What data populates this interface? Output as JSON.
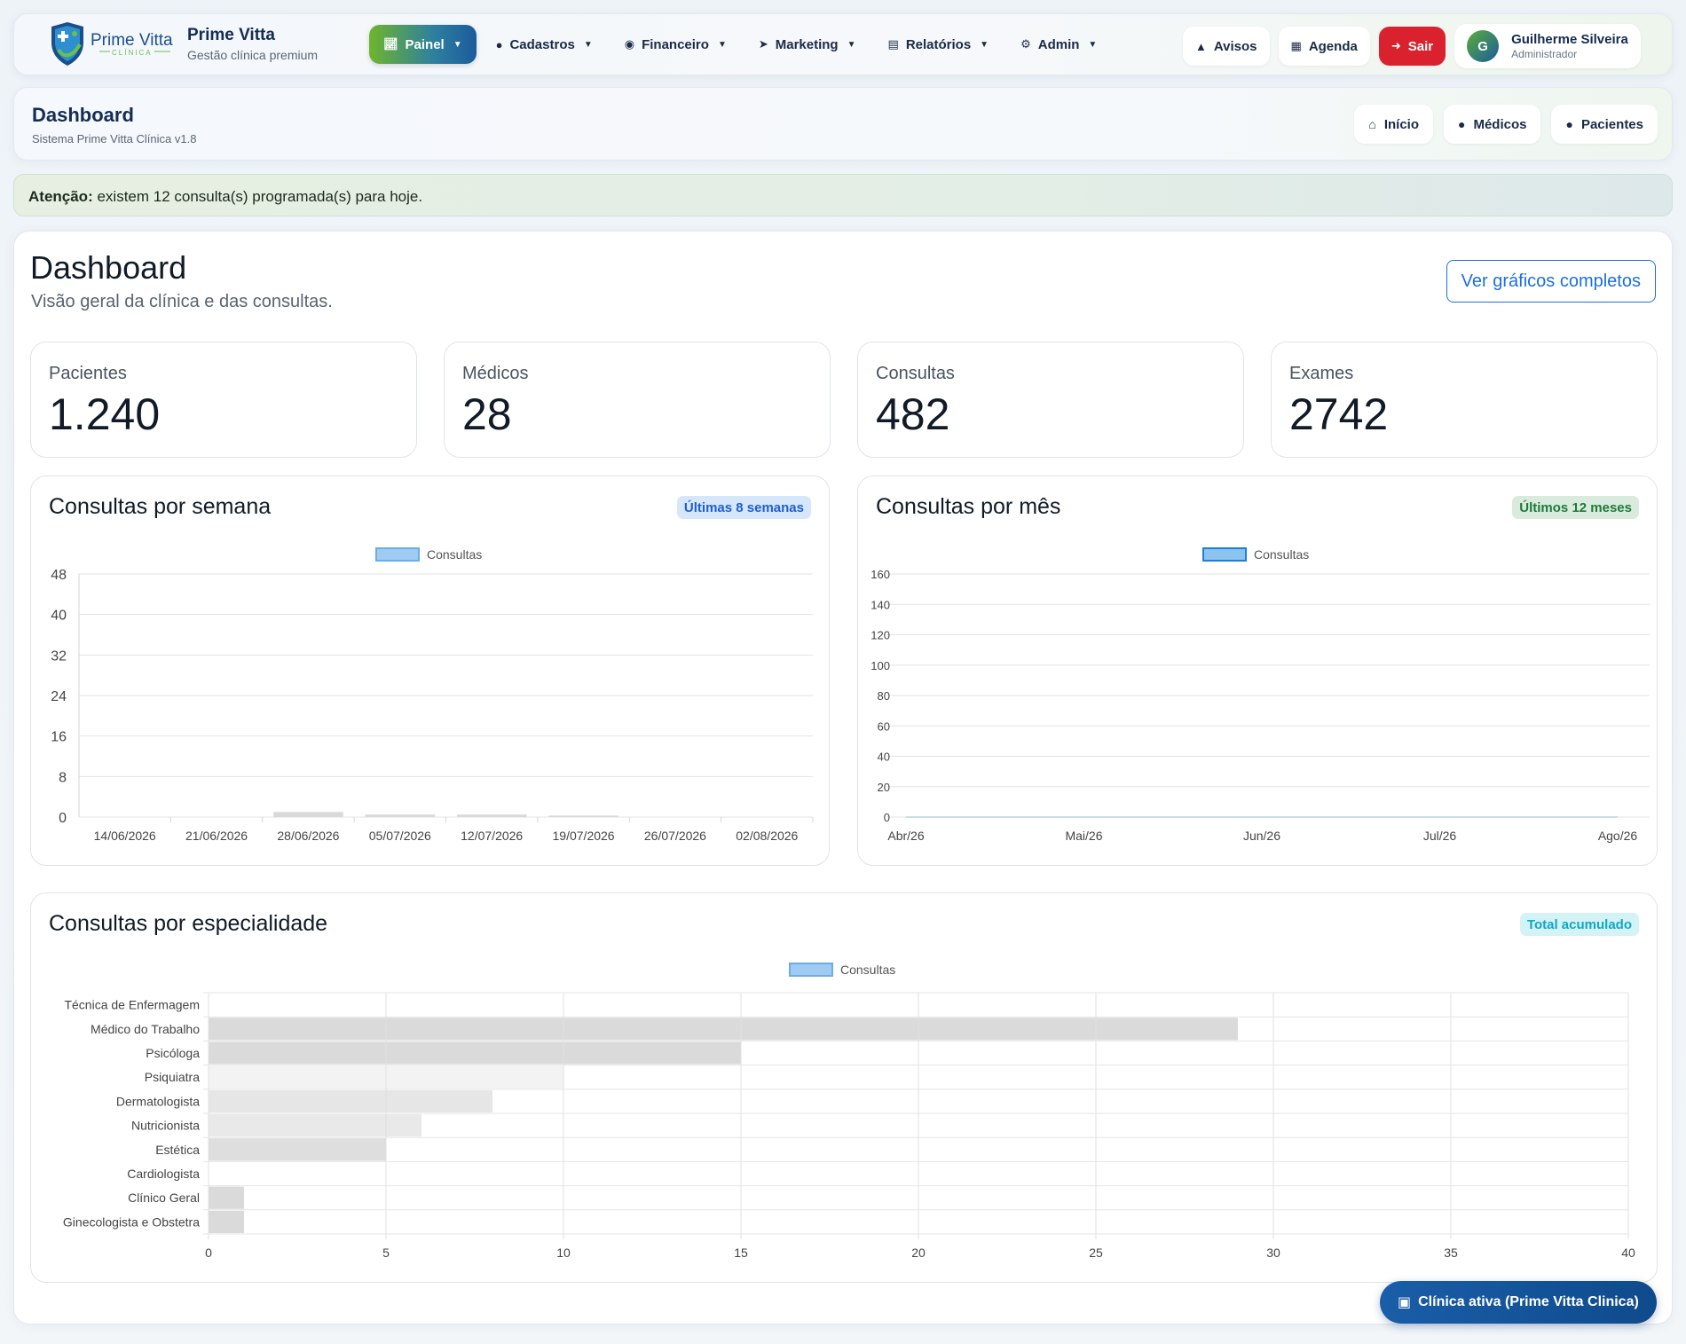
{
  "brand": {
    "logo_text": "Prime Vitta",
    "logo_sub": "CLÍNICA",
    "name": "Prime Vitta",
    "tagline": "Gestão clínica premium"
  },
  "nav": {
    "items": [
      {
        "label": "Painel",
        "icon": "chart-line-icon",
        "active": true
      },
      {
        "label": "Cadastros",
        "icon": "user-icon"
      },
      {
        "label": "Financeiro",
        "icon": "money-bag-icon"
      },
      {
        "label": "Marketing",
        "icon": "rocket-icon"
      },
      {
        "label": "Relatórios",
        "icon": "file-icon"
      },
      {
        "label": "Admin",
        "icon": "gears-icon"
      }
    ],
    "avisos": "Avisos",
    "agenda": "Agenda",
    "sair": "Sair",
    "user": {
      "initial": "G",
      "name": "Guilherme Silveira",
      "role": "Administrador"
    }
  },
  "page_header": {
    "title": "Dashboard",
    "subtitle": "Sistema Prime Vitta Clínica v1.8",
    "links": [
      {
        "label": "Início",
        "icon": "home-icon"
      },
      {
        "label": "Médicos",
        "icon": "user-doctor-icon"
      },
      {
        "label": "Pacientes",
        "icon": "user-injured-icon"
      }
    ]
  },
  "alert": {
    "strong": "Atenção:",
    "text": " existem 12 consulta(s) programada(s) para hoje."
  },
  "main": {
    "title": "Dashboard",
    "subtitle": "Visão geral da clínica e das consultas.",
    "full_charts_button": "Ver gráficos completos"
  },
  "stats": [
    {
      "label": "Pacientes",
      "value": "1.240"
    },
    {
      "label": "Médicos",
      "value": "28"
    },
    {
      "label": "Consultas",
      "value": "482"
    },
    {
      "label": "Exames",
      "value": "2742"
    }
  ],
  "charts": {
    "weekly": {
      "title": "Consultas por semana",
      "badge": "Últimas 8 semanas"
    },
    "monthly": {
      "title": "Consultas por mês",
      "badge": "Últimos 12 meses"
    },
    "specialty": {
      "title": "Consultas por especialidade",
      "badge": "Total acumulado"
    }
  },
  "chart_data": [
    {
      "type": "bar",
      "title": "",
      "series_name": "Consultas",
      "categories": [
        "14/06/2026",
        "21/06/2026",
        "28/06/2026",
        "05/07/2026",
        "12/07/2026",
        "19/07/2026",
        "26/07/2026",
        "02/08/2026"
      ],
      "values": [
        0,
        0,
        1,
        0.5,
        0.5,
        0.3,
        0,
        0
      ],
      "yticks": [
        "0",
        "8",
        "16",
        "24",
        "32",
        "40",
        "48"
      ],
      "ylim": [
        0,
        48
      ],
      "legend_color": "#9fcbf2",
      "legend_border": "#6aaee6"
    },
    {
      "type": "line",
      "title": "",
      "series_name": "Consultas",
      "categories": [
        "Abr/26",
        "Mai/26",
        "Jun/26",
        "Jul/26",
        "Ago/26"
      ],
      "values": [
        0,
        0,
        0,
        0,
        0
      ],
      "yticks": [
        "0",
        "20",
        "40",
        "60",
        "80",
        "100",
        "120",
        "140",
        "160"
      ],
      "ylim": [
        0,
        160
      ],
      "legend_color": "#8cc3ef",
      "legend_border": "#1f7fd6"
    },
    {
      "type": "bar",
      "orientation": "horizontal",
      "title": "",
      "series_name": "Consultas",
      "categories": [
        "Técnica de Enfermagem",
        "Médico do Trabalho",
        "Psicóloga",
        "Psiquiatra",
        "Dermatologista",
        "Nutricionista",
        "Estética",
        "Cardiologista",
        "Clínico Geral",
        "Ginecologista e Obstetra"
      ],
      "values": [
        0,
        29,
        15,
        10,
        8,
        6,
        5,
        0,
        1,
        1
      ],
      "xticks": [
        "0",
        "5",
        "10",
        "15",
        "20",
        "25",
        "30",
        "35",
        "40"
      ],
      "xlim": [
        0,
        40
      ],
      "bar_colors": [
        "#dadada",
        "#dadada",
        "#dadada",
        "#f3f3f3",
        "#e6e6e6",
        "#e9e9e9",
        "#dedede",
        "#dadada",
        "#dadada",
        "#dadada"
      ],
      "legend_color": "#9fcbf2",
      "legend_border": "#6aaee6"
    }
  ],
  "float_button": {
    "label": "Clínica ativa (Prime Vitta Clinica)",
    "icon": "hospital-icon"
  }
}
